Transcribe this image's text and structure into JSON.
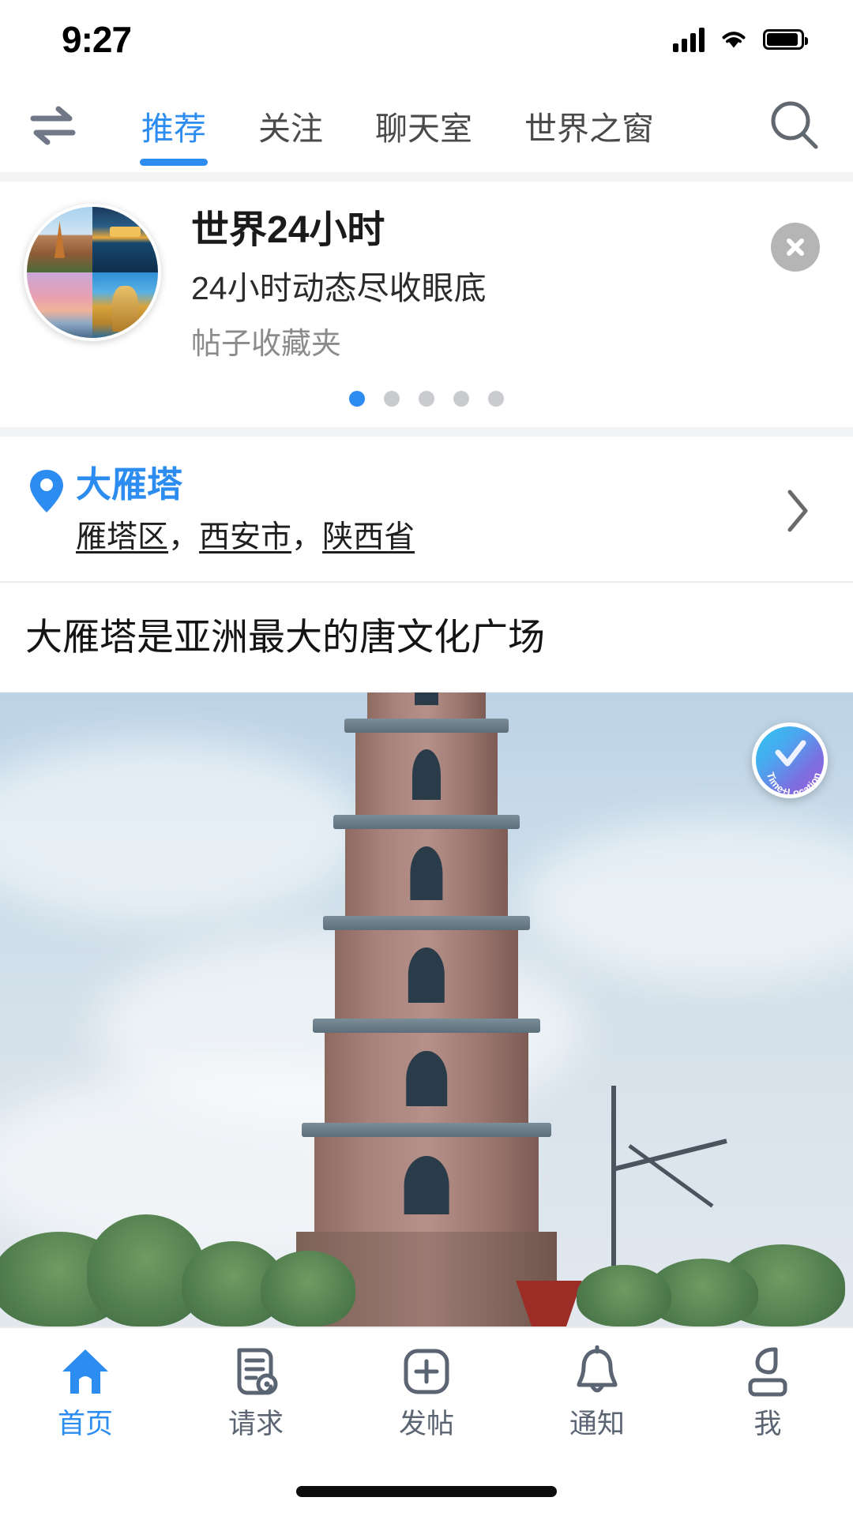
{
  "status_bar": {
    "time": "9:27",
    "signal_icon": "cellular-signal-icon",
    "wifi_icon": "wifi-icon",
    "battery_icon": "battery-icon"
  },
  "header": {
    "swap_icon": "swap-arrows-icon",
    "search_icon": "search-icon",
    "tabs": [
      {
        "label": "推荐",
        "active": true
      },
      {
        "label": "关注",
        "active": false
      },
      {
        "label": "聊天室",
        "active": false
      },
      {
        "label": "世界之窗",
        "active": false
      }
    ]
  },
  "promo_banner": {
    "avatar_name": "photo-collage-avatar",
    "title": "世界24小时",
    "subtitle": "24小时动态尽收眼底",
    "meta": "帖子收藏夹",
    "close_icon": "close-icon",
    "pagination": {
      "total": 5,
      "active_index": 0
    }
  },
  "location_card": {
    "pin_icon": "location-pin-icon",
    "place_name": "大雁塔",
    "district": "雁塔区",
    "city": "西安市",
    "province": "陕西省",
    "separator": "，",
    "chevron_icon": "chevron-right-icon"
  },
  "post": {
    "title": "大雁塔是亚洲最大的唐文化广场",
    "image_name": "big-wild-goose-pagoda-photo",
    "verified_badge": {
      "label": "Time+Location",
      "check_icon": "checkmark-icon"
    }
  },
  "bottom_nav": [
    {
      "label": "首页",
      "icon": "home-icon",
      "active": true
    },
    {
      "label": "请求",
      "icon": "document-location-icon",
      "active": false
    },
    {
      "label": "发帖",
      "icon": "plus-square-icon",
      "active": false
    },
    {
      "label": "通知",
      "icon": "bell-icon",
      "active": false
    },
    {
      "label": "我",
      "icon": "person-icon",
      "active": false
    }
  ],
  "colors": {
    "accent": "#2d8cf0",
    "inactive_text": "#5a6472",
    "strip_bg": "#f2f3f5",
    "close_bg": "#b5b5b5"
  }
}
